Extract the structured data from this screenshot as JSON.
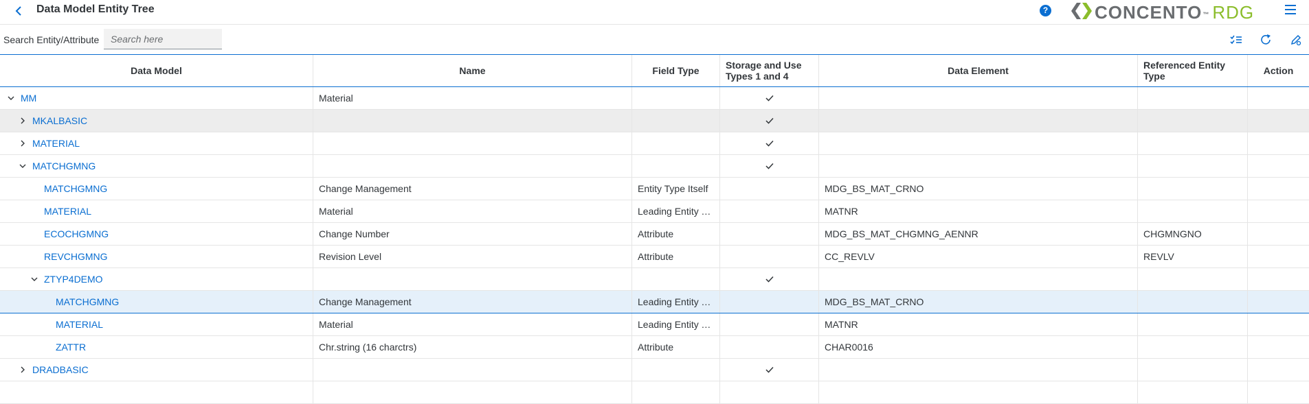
{
  "app": {
    "title": "Data Model Entity Tree",
    "logo_main": "CONCENTO",
    "logo_tm": "™",
    "logo_suffix": "RDG",
    "help_glyph": "?",
    "colors": {
      "accent": "#0a6ed1",
      "logo_gray": "#6a6d70",
      "logo_green": "#8bbd2b"
    }
  },
  "icons": {
    "back": "back-chevron-icon",
    "help": "help-icon",
    "menu": "hamburger-menu-icon",
    "select_all": "multi-select-icon",
    "refresh": "refresh-icon",
    "edit": "edit-icon",
    "expand": "chevron-right-icon",
    "collapse": "chevron-down-icon",
    "check": "checkmark-icon"
  },
  "search": {
    "label": "Search Entity/Attribute",
    "value": "",
    "placeholder": "Search here"
  },
  "columns": [
    "Data Model",
    "Name",
    "Field Type",
    "Storage and Use Types 1 and 4",
    "Data Element",
    "Referenced Entity Type",
    "Action"
  ],
  "rows": [
    {
      "level": 0,
      "expander": "collapse",
      "data_model": "MM",
      "name": "Material",
      "field_type": "",
      "storage_check": true,
      "data_element": "",
      "ref_entity": "",
      "action": ""
    },
    {
      "level": 1,
      "expander": "expand",
      "data_model": "MKALBASIC",
      "name": "",
      "field_type": "",
      "storage_check": true,
      "data_element": "",
      "ref_entity": "",
      "action": "",
      "state": "hover"
    },
    {
      "level": 1,
      "expander": "expand",
      "data_model": "MATERIAL",
      "name": "",
      "field_type": "",
      "storage_check": true,
      "data_element": "",
      "ref_entity": "",
      "action": ""
    },
    {
      "level": 1,
      "expander": "collapse",
      "data_model": "MATCHGMNG",
      "name": "",
      "field_type": "",
      "storage_check": true,
      "data_element": "",
      "ref_entity": "",
      "action": ""
    },
    {
      "level": 2,
      "expander": "",
      "data_model": "MATCHGMNG",
      "name": "Change Management",
      "field_type": "Entity Type Itself",
      "storage_check": false,
      "data_element": "MDG_BS_MAT_CRNO",
      "ref_entity": "",
      "action": ""
    },
    {
      "level": 2,
      "expander": "",
      "data_model": "MATERIAL",
      "name": "Material",
      "field_type": "Leading Entity T...",
      "storage_check": false,
      "data_element": "MATNR",
      "ref_entity": "",
      "action": ""
    },
    {
      "level": 2,
      "expander": "",
      "data_model": "ECOCHGMNG",
      "name": "Change Number",
      "field_type": "Attribute",
      "storage_check": false,
      "data_element": "MDG_BS_MAT_CHGMNG_AENNR",
      "ref_entity": "CHGMNGNO",
      "action": ""
    },
    {
      "level": 2,
      "expander": "",
      "data_model": "REVCHGMNG",
      "name": "Revision Level",
      "field_type": "Attribute",
      "storage_check": false,
      "data_element": "CC_REVLV",
      "ref_entity": "REVLV",
      "action": ""
    },
    {
      "level": 2,
      "expander": "collapse",
      "data_model": "ZTYP4DEMO",
      "name": "",
      "field_type": "",
      "storage_check": true,
      "data_element": "",
      "ref_entity": "",
      "action": ""
    },
    {
      "level": 3,
      "expander": "",
      "data_model": "MATCHGMNG",
      "name": "Change Management",
      "field_type": "Leading Entity T...",
      "storage_check": false,
      "data_element": "MDG_BS_MAT_CRNO",
      "ref_entity": "",
      "action": "",
      "state": "selected"
    },
    {
      "level": 3,
      "expander": "",
      "data_model": "MATERIAL",
      "name": "Material",
      "field_type": "Leading Entity T...",
      "storage_check": false,
      "data_element": "MATNR",
      "ref_entity": "",
      "action": ""
    },
    {
      "level": 3,
      "expander": "",
      "data_model": "ZATTR",
      "name": "Chr.string (16 charctrs)",
      "field_type": "Attribute",
      "storage_check": false,
      "data_element": "CHAR0016",
      "ref_entity": "",
      "action": ""
    },
    {
      "level": 1,
      "expander": "expand",
      "data_model": "DRADBASIC",
      "name": "",
      "field_type": "",
      "storage_check": true,
      "data_element": "",
      "ref_entity": "",
      "action": ""
    },
    {
      "level": 1,
      "expander": "",
      "data_model": "",
      "name": "",
      "field_type": "",
      "storage_check": false,
      "data_element": "",
      "ref_entity": "",
      "action": ""
    }
  ]
}
